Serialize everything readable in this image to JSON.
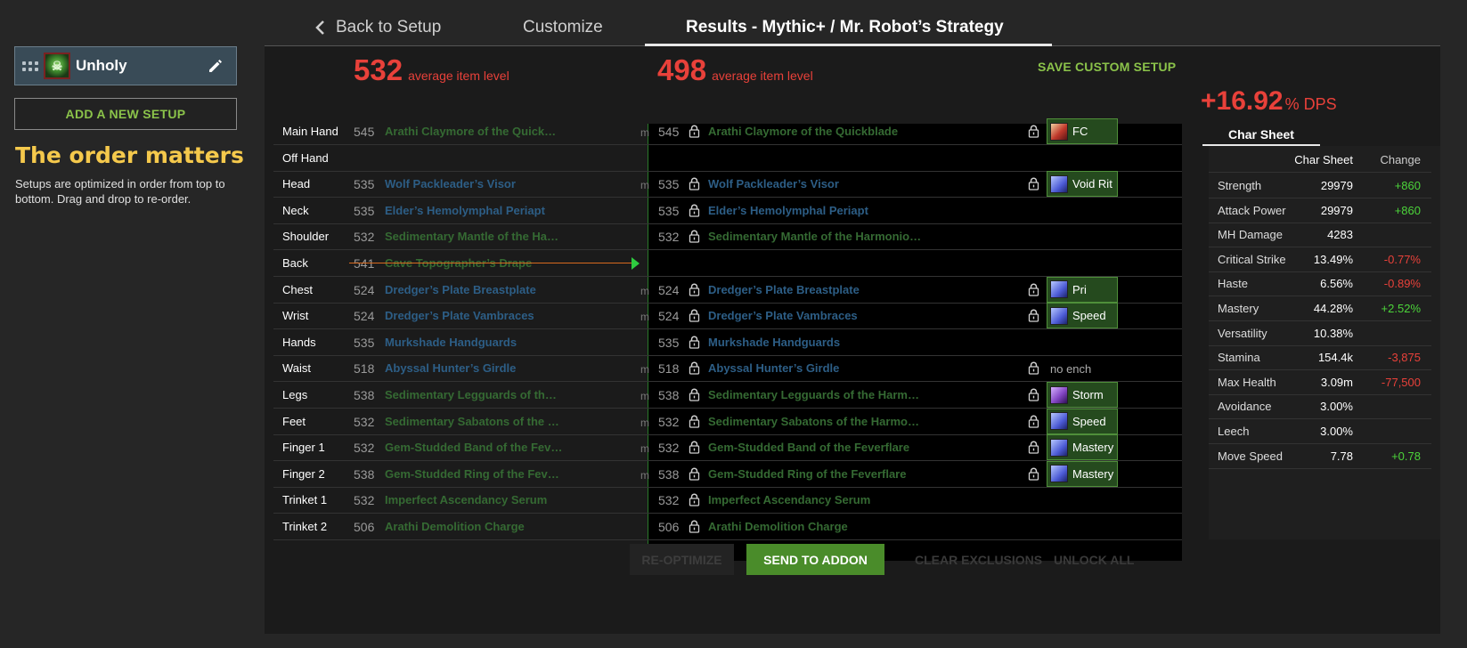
{
  "sidebar": {
    "setup_name": "Unholy",
    "add_setup_label": "ADD A NEW SETUP",
    "order_title": "The order matters",
    "order_desc": "Setups are optimized in order from top to bottom. Drag and drop to re-order."
  },
  "tabs": {
    "back": "Back to Setup",
    "customize": "Customize",
    "results": "Results - Mythic+ / Mr. Robot’s Strategy"
  },
  "current": {
    "ilvl": "532",
    "ilvl_label": "average item level"
  },
  "optimized": {
    "ilvl": "498",
    "ilvl_label": "average item level"
  },
  "save_custom_label": "SAVE CUSTOM SETUP",
  "gear": [
    {
      "slot": "Main Hand",
      "cur_lvl": "545",
      "cur_name": "Arathi Claymore of the Quickblade",
      "cur_color": "green",
      "m": "m",
      "new_lvl": "545",
      "new_name": "Arathi Claymore of the Quickblade",
      "new_color": "green",
      "ench": "FC",
      "ench_icon": "weapon"
    },
    {
      "slot": "Off Hand",
      "cur_lvl": "",
      "cur_name": "",
      "m": "",
      "new_lvl": "",
      "new_name": ""
    },
    {
      "slot": "Head",
      "cur_lvl": "535",
      "cur_name": "Wolf Packleader’s Visor",
      "cur_color": "blue",
      "m": "m",
      "new_lvl": "535",
      "new_name": "Wolf Packleader’s Visor",
      "new_color": "blue",
      "ench": "Void Rit",
      "ench_icon": "gem"
    },
    {
      "slot": "Neck",
      "cur_lvl": "535",
      "cur_name": "Elder’s Hemolymphal Periapt",
      "cur_color": "blue",
      "m": "",
      "new_lvl": "535",
      "new_name": "Elder’s Hemolymphal Periapt",
      "new_color": "blue"
    },
    {
      "slot": "Shoulder",
      "cur_lvl": "532",
      "cur_name": "Sedimentary Mantle of the Harmonious",
      "cur_color": "green",
      "m": "",
      "new_lvl": "532",
      "new_name": "Sedimentary Mantle of the Harmonious",
      "new_color": "green"
    },
    {
      "slot": "Back",
      "cur_lvl": "541",
      "cur_name": "Cave Topographer’s Drape",
      "cur_color": "green",
      "m": "",
      "new_lvl": "",
      "new_name": "",
      "struck": true
    },
    {
      "slot": "Chest",
      "cur_lvl": "524",
      "cur_name": "Dredger’s Plate Breastplate",
      "cur_color": "blue",
      "m": "m",
      "new_lvl": "524",
      "new_name": "Dredger’s Plate Breastplate",
      "new_color": "blue",
      "ench": "Pri",
      "ench_icon": "gem"
    },
    {
      "slot": "Wrist",
      "cur_lvl": "524",
      "cur_name": "Dredger’s Plate Vambraces",
      "cur_color": "blue",
      "m": "m",
      "new_lvl": "524",
      "new_name": "Dredger’s Plate Vambraces",
      "new_color": "blue",
      "ench": "Speed",
      "ench_icon": "gem"
    },
    {
      "slot": "Hands",
      "cur_lvl": "535",
      "cur_name": "Murkshade Handguards",
      "cur_color": "blue",
      "m": "",
      "new_lvl": "535",
      "new_name": "Murkshade Handguards",
      "new_color": "blue"
    },
    {
      "slot": "Waist",
      "cur_lvl": "518",
      "cur_name": "Abyssal Hunter’s Girdle",
      "cur_color": "blue",
      "m": "m",
      "new_lvl": "518",
      "new_name": "Abyssal Hunter’s Girdle",
      "new_color": "blue",
      "noench": "no ench"
    },
    {
      "slot": "Legs",
      "cur_lvl": "538",
      "cur_name": "Sedimentary Legguards of the Harmonious",
      "cur_color": "green",
      "m": "m",
      "new_lvl": "538",
      "new_name": "Sedimentary Legguards of the Harmonious",
      "new_color": "green",
      "ench": "Storm",
      "ench_icon": "purple"
    },
    {
      "slot": "Feet",
      "cur_lvl": "532",
      "cur_name": "Sedimentary Sabatons of the Harmonious",
      "cur_color": "green",
      "m": "m",
      "new_lvl": "532",
      "new_name": "Sedimentary Sabatons of the Harmonious",
      "new_color": "green",
      "ench": "Speed",
      "ench_icon": "gem"
    },
    {
      "slot": "Finger 1",
      "cur_lvl": "532",
      "cur_name": "Gem-Studded Band of the Feverflare",
      "cur_color": "green",
      "m": "m",
      "new_lvl": "532",
      "new_name": "Gem-Studded Band of the Feverflare",
      "new_color": "green",
      "ench": "Mastery",
      "ench_icon": "gem"
    },
    {
      "slot": "Finger 2",
      "cur_lvl": "538",
      "cur_name": "Gem-Studded Ring of the Feverflare",
      "cur_color": "green",
      "m": "m",
      "new_lvl": "538",
      "new_name": "Gem-Studded Ring of the Feverflare",
      "new_color": "green",
      "ench": "Mastery",
      "ench_icon": "gem"
    },
    {
      "slot": "Trinket 1",
      "cur_lvl": "532",
      "cur_name": "Imperfect Ascendancy Serum",
      "cur_color": "green",
      "m": "",
      "new_lvl": "532",
      "new_name": "Imperfect Ascendancy Serum",
      "new_color": "green"
    },
    {
      "slot": "Trinket 2",
      "cur_lvl": "506",
      "cur_name": "Arathi Demolition Charge",
      "cur_color": "green",
      "m": "",
      "new_lvl": "506",
      "new_name": "Arathi Demolition Charge",
      "new_color": "green"
    }
  ],
  "buttons": {
    "reoptimize": "RE-OPTIMIZE",
    "send": "SEND TO ADDON",
    "clear": "CLEAR EXCLUSIONS",
    "unlock": "UNLOCK ALL"
  },
  "dps": {
    "value": "+16.92",
    "unit": "% DPS"
  },
  "stats": {
    "tab": "Char Sheet",
    "col_value": "Char Sheet",
    "col_change": "Change",
    "rows": [
      {
        "name": "Strength",
        "value": "29979",
        "change": "+860"
      },
      {
        "name": "Attack Power",
        "value": "29979",
        "change": "+860"
      },
      {
        "name": "MH Damage",
        "value": "4283",
        "change": ""
      },
      {
        "name": "Critical Strike",
        "value": "13.49%",
        "change": "-0.77%"
      },
      {
        "name": "Haste",
        "value": "6.56%",
        "change": "-0.89%"
      },
      {
        "name": "Mastery",
        "value": "44.28%",
        "change": "+2.52%"
      },
      {
        "name": "Versatility",
        "value": "10.38%",
        "change": ""
      },
      {
        "name": "Stamina",
        "value": "154.4k",
        "change": "-3,875"
      },
      {
        "name": "Max Health",
        "value": "3.09m",
        "change": "-77,500"
      },
      {
        "name": "Avoidance",
        "value": "3.00%",
        "change": ""
      },
      {
        "name": "Leech",
        "value": "3.00%",
        "change": ""
      },
      {
        "name": "Move Speed",
        "value": "7.78",
        "change": "+0.78"
      }
    ]
  }
}
